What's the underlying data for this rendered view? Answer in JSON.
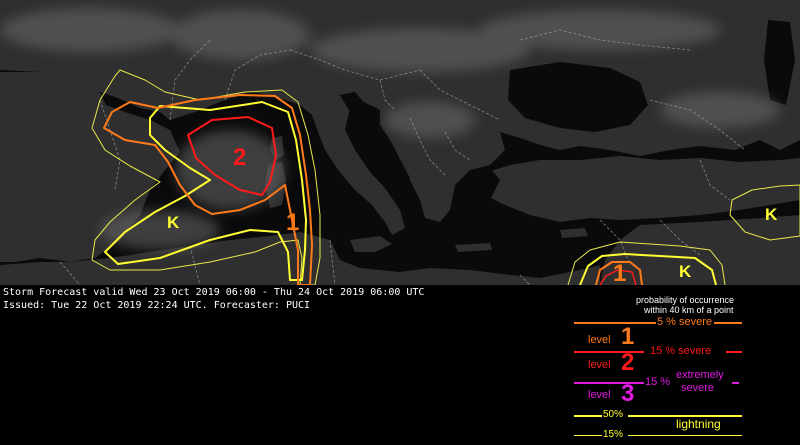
{
  "colors": {
    "level1": "#ff7a1a",
    "level2": "#ff1a1a",
    "level3": "#e01ae0",
    "lightning": "#ffff33"
  },
  "map": {
    "labels": {
      "level1_west": "1",
      "level2_west": "2",
      "level1_east": "1",
      "lightning_west": "K",
      "lightning_east": "K",
      "lightning_far_east": "K"
    }
  },
  "info": {
    "valid_line": "Storm Forecast valid Wed 23 Oct 2019 06:00 - Thu 24 Oct 2019 06:00 UTC",
    "issued_line": "Issued: Tue 22 Oct 2019 22:24 UTC. Forecaster: PUCI"
  },
  "legend": {
    "title_line1": "probability of occurrence",
    "title_line2": "within 40 km of a point",
    "level_word": "level",
    "level1_number": "1",
    "level2_number": "2",
    "level3_number": "3",
    "level1_prob": "5 % severe",
    "level2_prob": "15 % severe",
    "level3_prob": "15 %",
    "level3_desc_line1": "extremely",
    "level3_desc_line2": "severe",
    "lightning_50": "50%",
    "lightning_15": "15%",
    "lightning_word": "lightning"
  }
}
